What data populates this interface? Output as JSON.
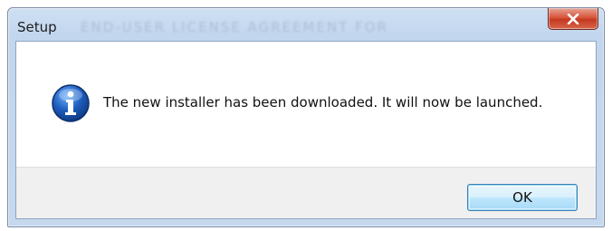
{
  "window": {
    "title": "Setup",
    "background_title": "END-USER LICENSE AGREEMENT FOR"
  },
  "dialog": {
    "icon": "info-icon",
    "message": "The new installer has been downloaded. It will now be launched."
  },
  "buttons": {
    "ok_label": "OK",
    "close_icon": "close-icon"
  },
  "colors": {
    "close_button": "#c94a32",
    "info_icon": "#1f5fbf",
    "ok_button_border": "#3c7fb1"
  }
}
